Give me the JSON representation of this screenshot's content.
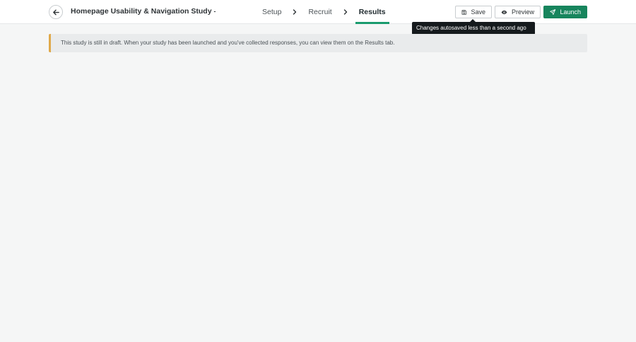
{
  "header": {
    "back_icon": "arrow-left-icon",
    "study_title": "Homepage Usability & Navigation Study – Q…"
  },
  "steps": [
    {
      "label": "Setup",
      "active": false
    },
    {
      "label": "Recruit",
      "active": false
    },
    {
      "label": "Results",
      "active": true
    }
  ],
  "actions": {
    "save_label": "Save",
    "save_icon": "floppy-disk-icon",
    "preview_label": "Preview",
    "preview_icon": "eye-icon",
    "launch_label": "Launch",
    "launch_icon": "rocket-icon"
  },
  "tooltip": {
    "text": "Changes autosaved less than a second ago"
  },
  "banner": {
    "text": "This study is still in draft. When your study has been launched and you've collected responses, you can view them on the Results tab.",
    "accent_color": "#e0a94a"
  },
  "colors": {
    "brand_green": "#17855d",
    "active_tab_underline": "#1a9b6e"
  }
}
